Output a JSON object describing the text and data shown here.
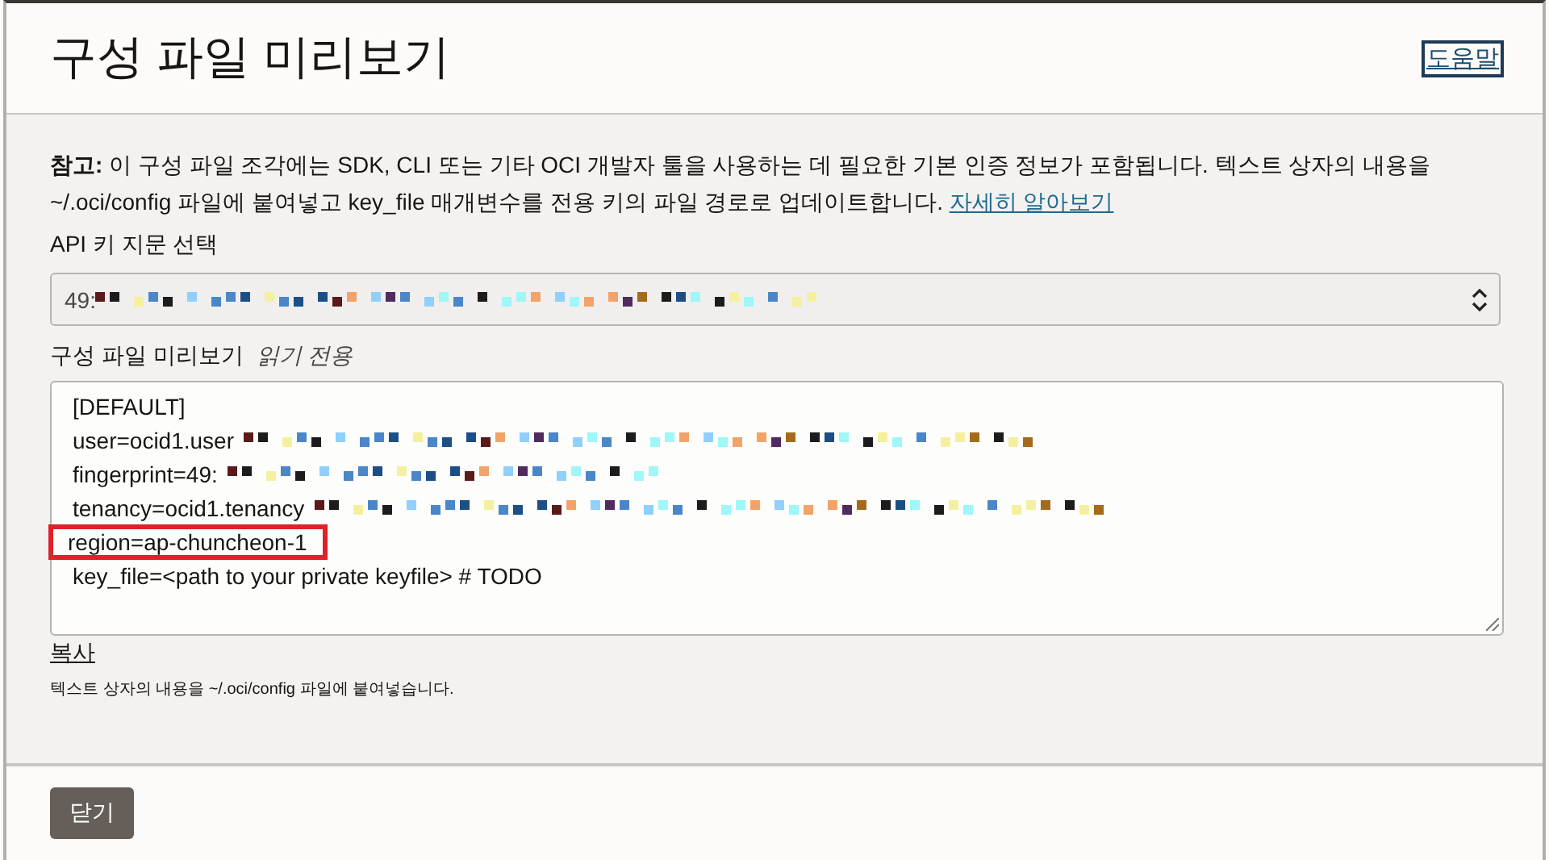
{
  "dialog": {
    "title": "구성 파일 미리보기",
    "help_link": "도움말"
  },
  "note": {
    "text": "**참고:** 이 구성 파일 조각에는 SDK, CLI 또는 기타 OCI 개발자 툴을 사용하는 데 필요한 기본 인증 정보가 포함됩니다. 텍스트 상자의 내용을 ~/.oci/config 파일에 붙여넣고 key_file 매개변수를 전용 키의 파일 경로로 업데이트합니다.",
    "link": "자세히 알아보기"
  },
  "fingerprint_select": {
    "label": "API 키 지문 선택",
    "value": "49:",
    "redacted": true
  },
  "config_preview": {
    "label": "구성 파일 미리보기",
    "hint": "읽기 전용",
    "lines": [
      {
        "text": "[DEFAULT]",
        "redacted": false,
        "highlighted": false
      },
      {
        "text": "user=ocid1.user",
        "redacted": true,
        "highlighted": false
      },
      {
        "text": "fingerprint=49:",
        "redacted": true,
        "highlighted": false
      },
      {
        "text": "tenancy=ocid1.tenancy",
        "redacted": true,
        "highlighted": false
      },
      {
        "text": "region=ap-chuncheon-1",
        "redacted": false,
        "highlighted": true
      },
      {
        "text": "key_file=<path to your private keyfile> # TODO",
        "redacted": false,
        "highlighted": false
      }
    ]
  },
  "copy_link": "복사",
  "copy_help": "텍스트 상자의 내용을 ~/.oci/config 파일에 붙여넣습니다.",
  "footer": {
    "close_button": "닫기"
  }
}
